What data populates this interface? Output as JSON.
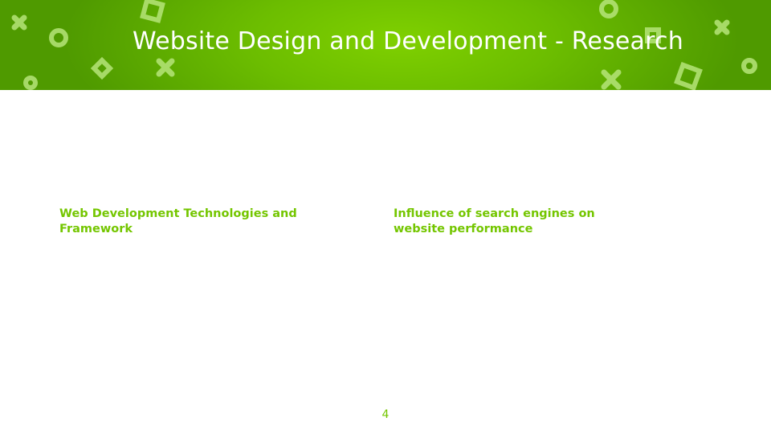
{
  "slide": {
    "title": "Website Design and Development - Research",
    "columns": [
      {
        "heading": "Web Development Technologies and Framework"
      },
      {
        "heading": "Influence of search engines on website performance"
      }
    ],
    "page_number": "4"
  },
  "colors": {
    "banner_green": "#6cbd00",
    "accent_green": "#74c600",
    "shape_color": "#a8df5f"
  }
}
